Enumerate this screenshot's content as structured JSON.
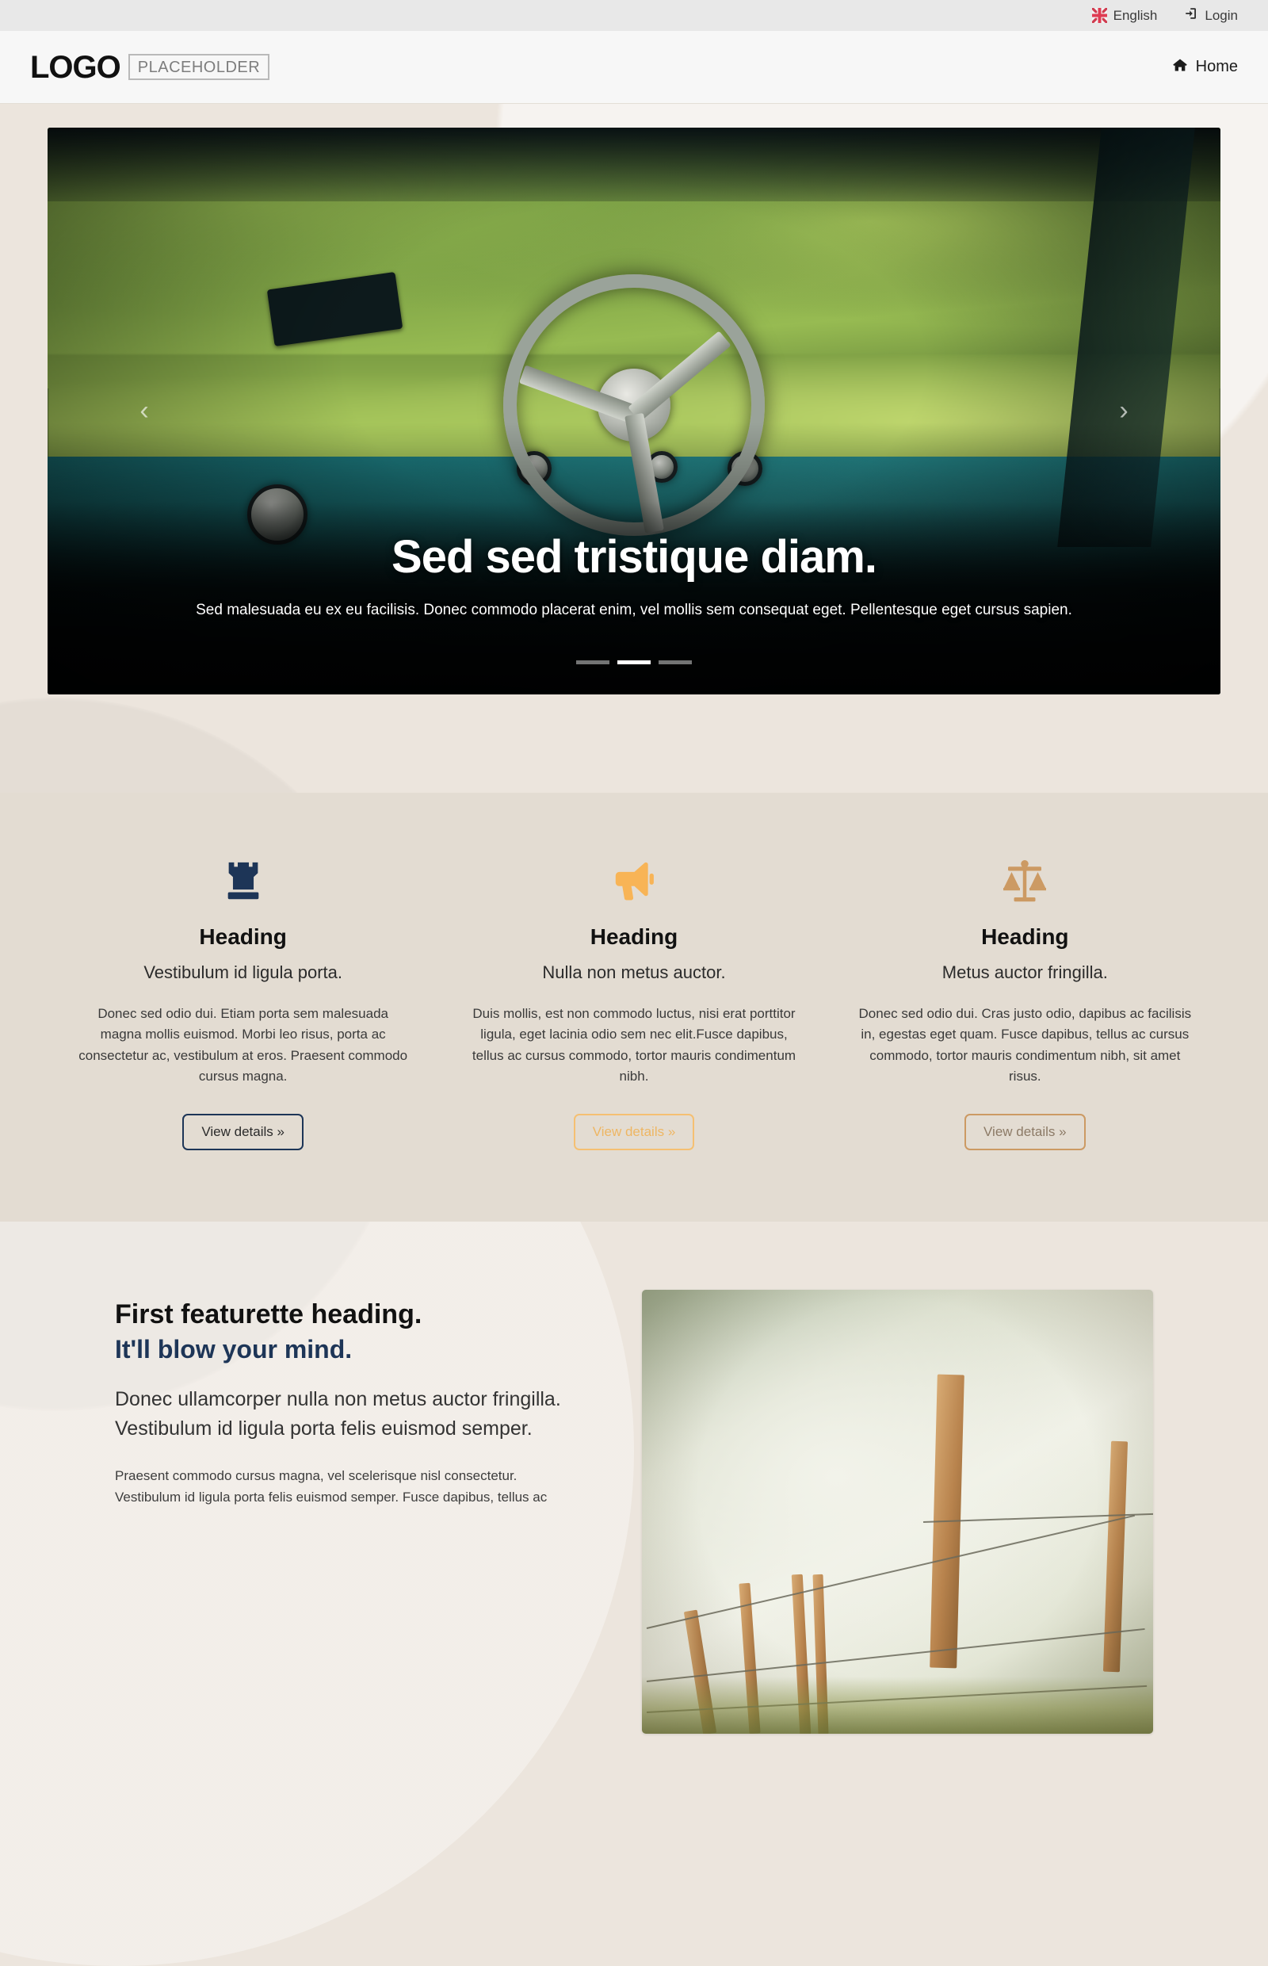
{
  "topbar": {
    "language": {
      "label": "English",
      "icon": "uk-flag-icon"
    },
    "login": {
      "label": "Login",
      "icon": "sign-in-icon"
    }
  },
  "navbar": {
    "logo_word": "LOGO",
    "logo_placeholder": "PLACEHOLDER",
    "links": [
      {
        "label": "Home",
        "icon": "home-icon"
      }
    ]
  },
  "carousel": {
    "title": "Sed sed tristique diam.",
    "subtitle": "Sed malesuada eu ex eu facilisis. Donec commodo placerat enim, vel mollis sem consequat eget. Pellentesque eget cursus sapien.",
    "prev_label": "‹",
    "next_label": "›",
    "slide_count": 3,
    "active_slide": 2
  },
  "features": {
    "columns": [
      {
        "icon": "chess-rook-icon",
        "icon_color": "#1d3557",
        "heading": "Heading",
        "lead": "Vestibulum id ligula porta.",
        "text": "Donec sed odio dui. Etiam porta sem malesuada magna mollis euismod. Morbi leo risus, porta ac consectetur ac, vestibulum at eros. Praesent commodo cursus magna.",
        "button_label": "View details »",
        "button_style": "navy"
      },
      {
        "icon": "megaphone-icon",
        "icon_color": "#f8b456",
        "heading": "Heading",
        "lead": "Nulla non metus auctor.",
        "text": "Duis mollis, est non commodo luctus, nisi erat porttitor ligula, eget lacinia odio sem nec elit.Fusce dapibus, tellus ac cursus commodo, tortor mauris condimentum nibh.",
        "button_label": "View details »",
        "button_style": "orange"
      },
      {
        "icon": "balance-scale-icon",
        "icon_color": "#cc9a63",
        "heading": "Heading",
        "lead": "Metus auctor fringilla.",
        "text": "Donec sed odio dui. Cras justo odio, dapibus ac facilisis in, egestas eget quam. Fusce dapibus, tellus ac cursus commodo, tortor mauris condimentum nibh, sit amet risus.",
        "button_label": "View details »",
        "button_style": "tan"
      }
    ]
  },
  "featurette": {
    "heading": "First featurette heading.",
    "subheading": "It'll blow your mind.",
    "lead": "Donec ullamcorper nulla non metus auctor fringilla. Vestibulum id ligula porta felis euismod semper.",
    "body": "Praesent commodo cursus magna, vel scelerisque nisl consectetur. Vestibulum id ligula porta felis euismod semper. Fusce dapibus, tellus ac",
    "image_alt": "barbed-wire-fence-photo"
  },
  "colors": {
    "page_background": "#ece5dd",
    "features_band": "#e3dcd2",
    "navy": "#1d3557",
    "orange": "#f8b456",
    "tan": "#cc9a63",
    "topbar": "#e8e8e8",
    "navbar": "#f7f7f7"
  }
}
